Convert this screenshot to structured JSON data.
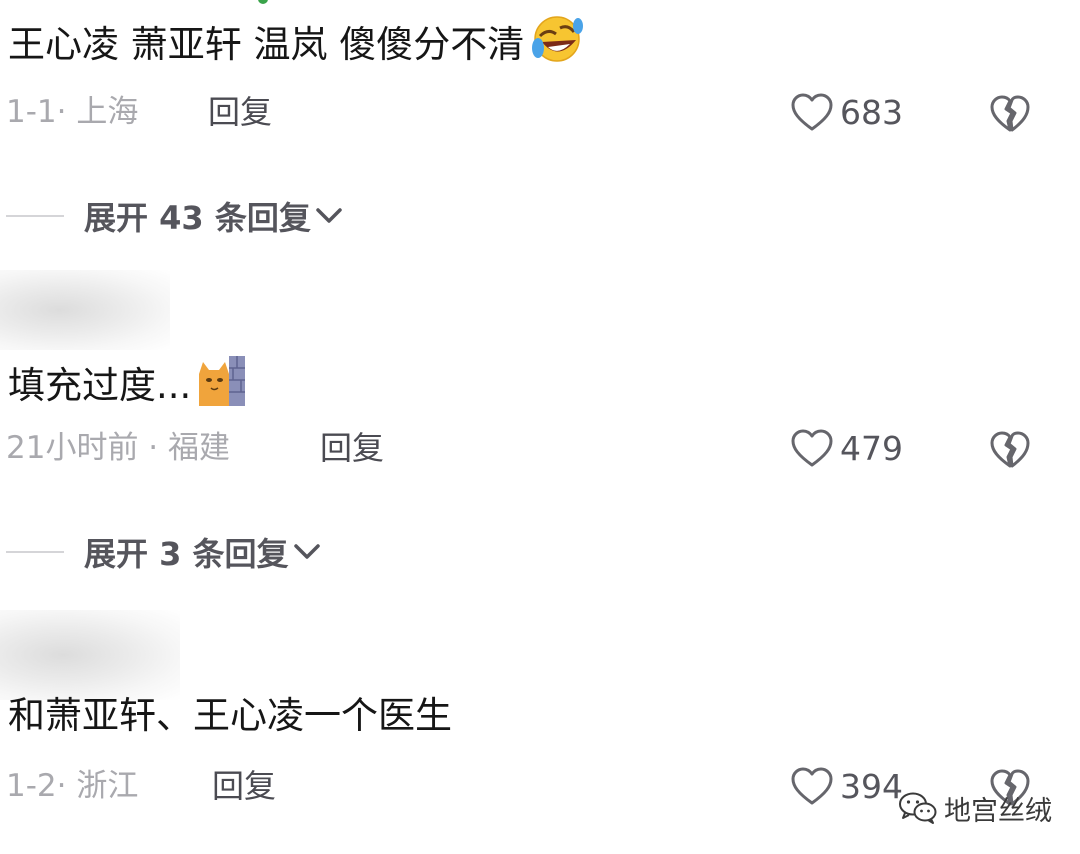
{
  "comments": [
    {
      "text": "王心凌 萧亚轩 温岚 傻傻分不清",
      "emoji": "rolling-on-floor-laughing-emoji",
      "meta": "1-1· 上海",
      "reply_label": "回复",
      "likes": "683"
    },
    {
      "text": "填充过度...",
      "emoji": "cat-peeking-behind-wall-emoji",
      "meta": "21小时前 · 福建",
      "reply_label": "回复",
      "likes": "479"
    },
    {
      "text": "和萧亚轩、王心凌一个医生",
      "meta": "1-2· 浙江",
      "reply_label": "回复",
      "likes": "394"
    }
  ],
  "expanders": [
    {
      "label": "展开 43 条回复"
    },
    {
      "label": "展开 3 条回复"
    }
  ],
  "watermark": {
    "text": "地宫丝绒",
    "icon": "wechat-icon"
  },
  "colors": {
    "text": "#161616",
    "meta": "#a9a9ae",
    "action": "#55555c",
    "divider": "#d5d5d8"
  }
}
